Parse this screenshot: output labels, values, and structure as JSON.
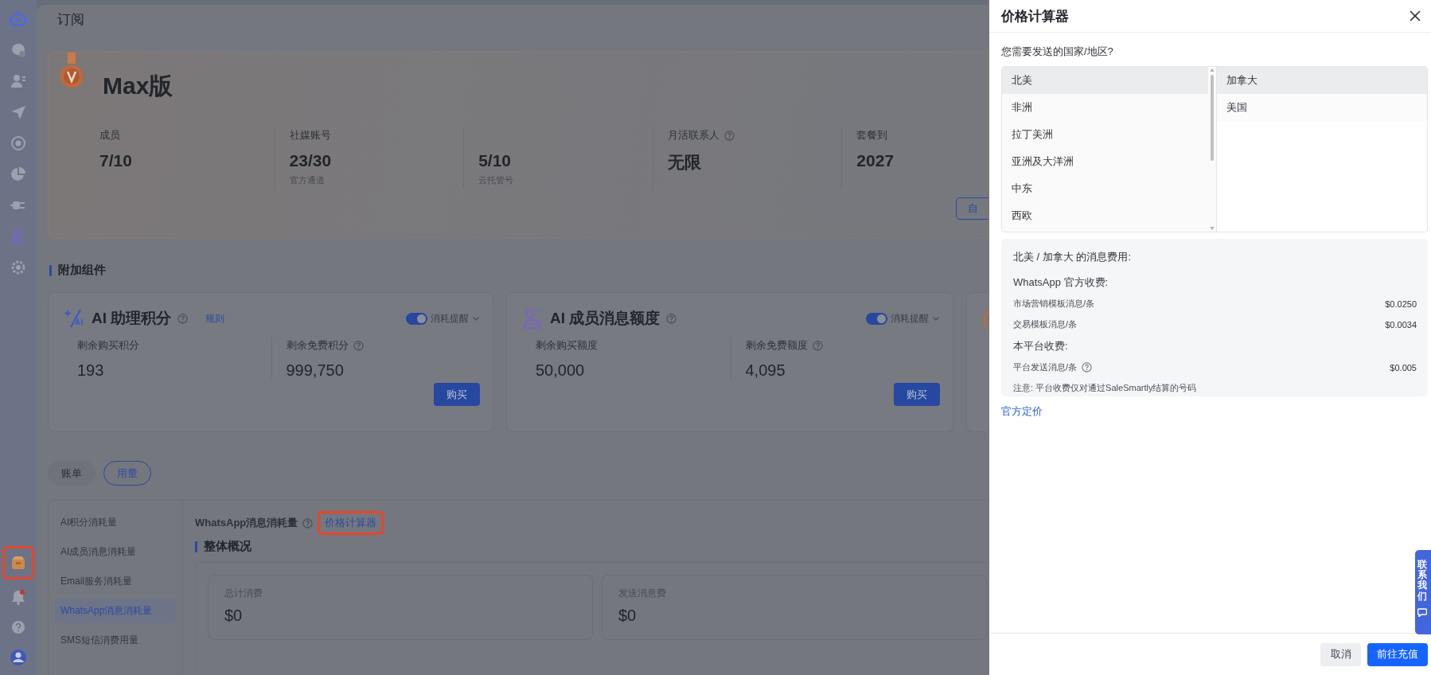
{
  "sidebar": {
    "top_items": [
      {
        "kind": "logo",
        "highlighted": false
      },
      {
        "kind": "chat",
        "highlighted": false
      },
      {
        "kind": "contacts",
        "highlighted": false
      },
      {
        "kind": "send",
        "highlighted": false
      },
      {
        "kind": "broadcast",
        "highlighted": false
      },
      {
        "kind": "chart",
        "highlighted": false
      },
      {
        "kind": "plugin",
        "highlighted": false
      },
      {
        "kind": "ai-agent",
        "highlighted": false
      },
      {
        "kind": "settings",
        "highlighted": false
      }
    ],
    "bottom_items": [
      {
        "kind": "subscription",
        "highlighted": true
      },
      {
        "kind": "notifications",
        "highlighted": false,
        "badge": true
      },
      {
        "kind": "help",
        "highlighted": false
      },
      {
        "kind": "avatar",
        "highlighted": false
      }
    ]
  },
  "page": {
    "title": "订阅"
  },
  "plan": {
    "name": "Max版",
    "stats": [
      {
        "label": "成员",
        "value": "7/10"
      },
      {
        "label": "社媒账号",
        "value": "23/30",
        "note": "官方通道"
      },
      {
        "value": "5/10",
        "note": "云托管号"
      },
      {
        "label": "月活联系人",
        "help": true,
        "value": "无限"
      },
      {
        "label": "套餐到",
        "value": "2027"
      }
    ],
    "button": "自"
  },
  "addons": {
    "heading": "附加组件",
    "cards": [
      {
        "kind": "ai-points",
        "title": "AI 助理积分",
        "help": true,
        "link": "规则",
        "reminder_on": true,
        "reminder_label": "消耗提醒",
        "stats": [
          {
            "label": "剩余购买积分",
            "value": "193"
          },
          {
            "label": "剩余免费积分",
            "help": true,
            "value": "999,750"
          }
        ],
        "button": "购买"
      },
      {
        "kind": "ai-member",
        "title": "AI 成员消息额度",
        "help": true,
        "reminder_on": true,
        "reminder_label": "消耗提醒",
        "stats": [
          {
            "label": "剩余购买额度",
            "value": "50,000"
          },
          {
            "label": "剩余免费额度",
            "help": true,
            "value": "4,095"
          }
        ],
        "button": "购买"
      },
      {
        "kind": "box"
      }
    ]
  },
  "tabs": [
    {
      "label": "账单",
      "selected": false
    },
    {
      "label": "用量",
      "selected": true
    }
  ],
  "usage": {
    "nav": [
      {
        "label": "AI积分消耗量",
        "selected": false
      },
      {
        "label": "AI成员消息消耗量",
        "selected": false
      },
      {
        "label": "Email服务消耗量",
        "selected": false
      },
      {
        "label": "WhatsApp消息消耗量",
        "selected": true
      },
      {
        "label": "SMS短信消费用量",
        "selected": false
      }
    ],
    "title": "WhatsApp消息消耗量",
    "help": true,
    "link": {
      "label": "价格计算器",
      "highlighted": true
    },
    "section": "整体概况",
    "summary": [
      {
        "label": "总计消费",
        "value": "$0"
      },
      {
        "label": "发送消息费",
        "value": "$0"
      }
    ]
  },
  "drawer": {
    "title": "价格计算器",
    "question": "您需要发送的国家/地区?",
    "regions": [
      {
        "label": "北美",
        "selected": true
      },
      {
        "label": "非洲",
        "selected": false
      },
      {
        "label": "拉丁美洲",
        "selected": false
      },
      {
        "label": "亚洲及大洋洲",
        "selected": false
      },
      {
        "label": "中东",
        "selected": false
      },
      {
        "label": "西欧",
        "selected": false
      }
    ],
    "countries": [
      {
        "label": "加拿大",
        "selected": true
      },
      {
        "label": "美国",
        "selected": false
      }
    ],
    "fees": {
      "heading": "北美 / 加拿大 的消息费用:",
      "groups": [
        {
          "title": "WhatsApp 官方收费:",
          "rows": [
            {
              "label": "市场营销模板消息/条",
              "price": "$0.0250"
            },
            {
              "label": "交易模板消息/条",
              "price": "$0.0034"
            }
          ]
        },
        {
          "title": "本平台收费:",
          "rows": [
            {
              "label": "平台发送消息/条",
              "help": true,
              "price": "$0.005"
            }
          ]
        }
      ],
      "note": "注意: 平台收费仅对通过SaleSmartly结算的号码"
    },
    "link": "官方定价",
    "buttons": [
      {
        "label": "取消",
        "kind": "secondary"
      },
      {
        "label": "前往充值",
        "kind": "primary"
      }
    ]
  },
  "contact_tab": {
    "label": "联系我们"
  }
}
